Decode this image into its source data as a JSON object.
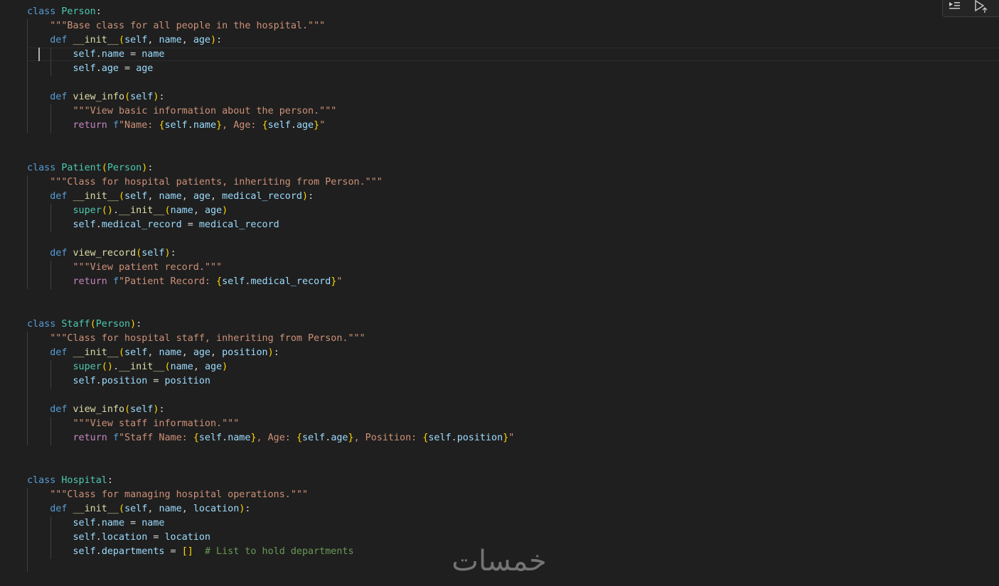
{
  "editor": {
    "lines": [
      [
        [
          "kw",
          "class"
        ],
        [
          "op",
          " "
        ],
        [
          "cls",
          "Person"
        ],
        [
          "op",
          ":"
        ]
      ],
      [
        [
          "op",
          "    "
        ],
        [
          "str",
          "\"\"\"Base class for all people in the hospital.\"\"\""
        ]
      ],
      [
        [
          "op",
          "    "
        ],
        [
          "kw",
          "def"
        ],
        [
          "op",
          " "
        ],
        [
          "fn",
          "__init__"
        ],
        [
          "br1",
          "("
        ],
        [
          "var",
          "self"
        ],
        [
          "op",
          ", "
        ],
        [
          "var",
          "name"
        ],
        [
          "op",
          ", "
        ],
        [
          "var",
          "age"
        ],
        [
          "br1",
          ")"
        ],
        [
          "op",
          ":"
        ]
      ],
      [
        [
          "op",
          "        "
        ],
        [
          "var",
          "self"
        ],
        [
          "op",
          "."
        ],
        [
          "var",
          "name"
        ],
        [
          "op",
          " = "
        ],
        [
          "var",
          "name"
        ]
      ],
      [
        [
          "op",
          "        "
        ],
        [
          "var",
          "self"
        ],
        [
          "op",
          "."
        ],
        [
          "var",
          "age"
        ],
        [
          "op",
          " = "
        ],
        [
          "var",
          "age"
        ]
      ],
      [],
      [
        [
          "op",
          "    "
        ],
        [
          "kw",
          "def"
        ],
        [
          "op",
          " "
        ],
        [
          "fn",
          "view_info"
        ],
        [
          "br1",
          "("
        ],
        [
          "var",
          "self"
        ],
        [
          "br1",
          ")"
        ],
        [
          "op",
          ":"
        ]
      ],
      [
        [
          "op",
          "        "
        ],
        [
          "str",
          "\"\"\"View basic information about the person.\"\"\""
        ]
      ],
      [
        [
          "op",
          "        "
        ],
        [
          "ctl",
          "return"
        ],
        [
          "op",
          " "
        ],
        [
          "kw",
          "f"
        ],
        [
          "str",
          "\"Name: "
        ],
        [
          "br1",
          "{"
        ],
        [
          "var",
          "self"
        ],
        [
          "op",
          "."
        ],
        [
          "var",
          "name"
        ],
        [
          "br1",
          "}"
        ],
        [
          "str",
          ", Age: "
        ],
        [
          "br1",
          "{"
        ],
        [
          "var",
          "self"
        ],
        [
          "op",
          "."
        ],
        [
          "var",
          "age"
        ],
        [
          "br1",
          "}"
        ],
        [
          "str",
          "\""
        ]
      ],
      [],
      [],
      [
        [
          "kw",
          "class"
        ],
        [
          "op",
          " "
        ],
        [
          "cls",
          "Patient"
        ],
        [
          "br1",
          "("
        ],
        [
          "cls",
          "Person"
        ],
        [
          "br1",
          ")"
        ],
        [
          "op",
          ":"
        ]
      ],
      [
        [
          "op",
          "    "
        ],
        [
          "str",
          "\"\"\"Class for hospital patients, inheriting from Person.\"\"\""
        ]
      ],
      [
        [
          "op",
          "    "
        ],
        [
          "kw",
          "def"
        ],
        [
          "op",
          " "
        ],
        [
          "fn",
          "__init__"
        ],
        [
          "br1",
          "("
        ],
        [
          "var",
          "self"
        ],
        [
          "op",
          ", "
        ],
        [
          "var",
          "name"
        ],
        [
          "op",
          ", "
        ],
        [
          "var",
          "age"
        ],
        [
          "op",
          ", "
        ],
        [
          "var",
          "medical_record"
        ],
        [
          "br1",
          ")"
        ],
        [
          "op",
          ":"
        ]
      ],
      [
        [
          "op",
          "        "
        ],
        [
          "cls",
          "super"
        ],
        [
          "br1",
          "("
        ],
        [
          "br1",
          ")"
        ],
        [
          "op",
          "."
        ],
        [
          "fn",
          "__init__"
        ],
        [
          "br1",
          "("
        ],
        [
          "var",
          "name"
        ],
        [
          "op",
          ", "
        ],
        [
          "var",
          "age"
        ],
        [
          "br1",
          ")"
        ]
      ],
      [
        [
          "op",
          "        "
        ],
        [
          "var",
          "self"
        ],
        [
          "op",
          "."
        ],
        [
          "var",
          "medical_record"
        ],
        [
          "op",
          " = "
        ],
        [
          "var",
          "medical_record"
        ]
      ],
      [],
      [
        [
          "op",
          "    "
        ],
        [
          "kw",
          "def"
        ],
        [
          "op",
          " "
        ],
        [
          "fn",
          "view_record"
        ],
        [
          "br1",
          "("
        ],
        [
          "var",
          "self"
        ],
        [
          "br1",
          ")"
        ],
        [
          "op",
          ":"
        ]
      ],
      [
        [
          "op",
          "        "
        ],
        [
          "str",
          "\"\"\"View patient record.\"\"\""
        ]
      ],
      [
        [
          "op",
          "        "
        ],
        [
          "ctl",
          "return"
        ],
        [
          "op",
          " "
        ],
        [
          "kw",
          "f"
        ],
        [
          "str",
          "\"Patient Record: "
        ],
        [
          "br1",
          "{"
        ],
        [
          "var",
          "self"
        ],
        [
          "op",
          "."
        ],
        [
          "var",
          "medical_record"
        ],
        [
          "br1",
          "}"
        ],
        [
          "str",
          "\""
        ]
      ],
      [],
      [],
      [
        [
          "kw",
          "class"
        ],
        [
          "op",
          " "
        ],
        [
          "cls",
          "Staff"
        ],
        [
          "br1",
          "("
        ],
        [
          "cls",
          "Person"
        ],
        [
          "br1",
          ")"
        ],
        [
          "op",
          ":"
        ]
      ],
      [
        [
          "op",
          "    "
        ],
        [
          "str",
          "\"\"\"Class for hospital staff, inheriting from Person.\"\"\""
        ]
      ],
      [
        [
          "op",
          "    "
        ],
        [
          "kw",
          "def"
        ],
        [
          "op",
          " "
        ],
        [
          "fn",
          "__init__"
        ],
        [
          "br1",
          "("
        ],
        [
          "var",
          "self"
        ],
        [
          "op",
          ", "
        ],
        [
          "var",
          "name"
        ],
        [
          "op",
          ", "
        ],
        [
          "var",
          "age"
        ],
        [
          "op",
          ", "
        ],
        [
          "var",
          "position"
        ],
        [
          "br1",
          ")"
        ],
        [
          "op",
          ":"
        ]
      ],
      [
        [
          "op",
          "        "
        ],
        [
          "cls",
          "super"
        ],
        [
          "br1",
          "("
        ],
        [
          "br1",
          ")"
        ],
        [
          "op",
          "."
        ],
        [
          "fn",
          "__init__"
        ],
        [
          "br1",
          "("
        ],
        [
          "var",
          "name"
        ],
        [
          "op",
          ", "
        ],
        [
          "var",
          "age"
        ],
        [
          "br1",
          ")"
        ]
      ],
      [
        [
          "op",
          "        "
        ],
        [
          "var",
          "self"
        ],
        [
          "op",
          "."
        ],
        [
          "var",
          "position"
        ],
        [
          "op",
          " = "
        ],
        [
          "var",
          "position"
        ]
      ],
      [],
      [
        [
          "op",
          "    "
        ],
        [
          "kw",
          "def"
        ],
        [
          "op",
          " "
        ],
        [
          "fn",
          "view_info"
        ],
        [
          "br1",
          "("
        ],
        [
          "var",
          "self"
        ],
        [
          "br1",
          ")"
        ],
        [
          "op",
          ":"
        ]
      ],
      [
        [
          "op",
          "        "
        ],
        [
          "str",
          "\"\"\"View staff information.\"\"\""
        ]
      ],
      [
        [
          "op",
          "        "
        ],
        [
          "ctl",
          "return"
        ],
        [
          "op",
          " "
        ],
        [
          "kw",
          "f"
        ],
        [
          "str",
          "\"Staff Name: "
        ],
        [
          "br1",
          "{"
        ],
        [
          "var",
          "self"
        ],
        [
          "op",
          "."
        ],
        [
          "var",
          "name"
        ],
        [
          "br1",
          "}"
        ],
        [
          "str",
          ", Age: "
        ],
        [
          "br1",
          "{"
        ],
        [
          "var",
          "self"
        ],
        [
          "op",
          "."
        ],
        [
          "var",
          "age"
        ],
        [
          "br1",
          "}"
        ],
        [
          "str",
          ", Position: "
        ],
        [
          "br1",
          "{"
        ],
        [
          "var",
          "self"
        ],
        [
          "op",
          "."
        ],
        [
          "var",
          "position"
        ],
        [
          "br1",
          "}"
        ],
        [
          "str",
          "\""
        ]
      ],
      [],
      [],
      [
        [
          "kw",
          "class"
        ],
        [
          "op",
          " "
        ],
        [
          "cls",
          "Hospital"
        ],
        [
          "op",
          ":"
        ]
      ],
      [
        [
          "op",
          "    "
        ],
        [
          "str",
          "\"\"\"Class for managing hospital operations.\"\"\""
        ]
      ],
      [
        [
          "op",
          "    "
        ],
        [
          "kw",
          "def"
        ],
        [
          "op",
          " "
        ],
        [
          "fn",
          "__init__"
        ],
        [
          "br1",
          "("
        ],
        [
          "var",
          "self"
        ],
        [
          "op",
          ", "
        ],
        [
          "var",
          "name"
        ],
        [
          "op",
          ", "
        ],
        [
          "var",
          "location"
        ],
        [
          "br1",
          ")"
        ],
        [
          "op",
          ":"
        ]
      ],
      [
        [
          "op",
          "        "
        ],
        [
          "var",
          "self"
        ],
        [
          "op",
          "."
        ],
        [
          "var",
          "name"
        ],
        [
          "op",
          " = "
        ],
        [
          "var",
          "name"
        ]
      ],
      [
        [
          "op",
          "        "
        ],
        [
          "var",
          "self"
        ],
        [
          "op",
          "."
        ],
        [
          "var",
          "location"
        ],
        [
          "op",
          " = "
        ],
        [
          "var",
          "location"
        ]
      ],
      [
        [
          "op",
          "        "
        ],
        [
          "var",
          "self"
        ],
        [
          "op",
          "."
        ],
        [
          "var",
          "departments"
        ],
        [
          "op",
          " = "
        ],
        [
          "br1",
          "[]"
        ],
        [
          "op",
          "  "
        ],
        [
          "cmt",
          "# List to hold departments"
        ]
      ]
    ]
  },
  "toolbar": {
    "run_by_line_icon": "run-by-line-icon",
    "execute_icon": "execute-cell-icon"
  },
  "watermark": {
    "text": "خمسات"
  },
  "theme": {
    "background": "#1f1f1f",
    "keyword": "#569cd6",
    "class_name": "#4ec9b0",
    "function": "#dcdcaa",
    "variable": "#9cdcfe",
    "string": "#ce9178",
    "comment": "#6a9955"
  }
}
